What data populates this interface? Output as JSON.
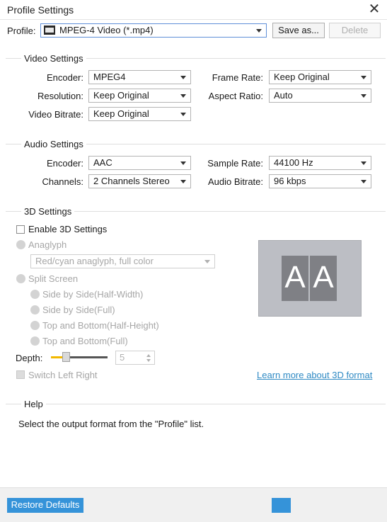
{
  "window": {
    "title": "Profile Settings",
    "close_glyph": "✕"
  },
  "profile": {
    "label": "Profile:",
    "value": "MPEG-4 Video (*.mp4)",
    "icon": "mp4-file-icon",
    "save_as": "Save as...",
    "delete": "Delete"
  },
  "video": {
    "title": "Video Settings",
    "encoder_label": "Encoder:",
    "encoder": "MPEG4",
    "resolution_label": "Resolution:",
    "resolution": "Keep Original",
    "bitrate_label": "Video Bitrate:",
    "bitrate": "Keep Original",
    "framerate_label": "Frame Rate:",
    "framerate": "Keep Original",
    "aspect_label": "Aspect Ratio:",
    "aspect": "Auto"
  },
  "audio": {
    "title": "Audio Settings",
    "encoder_label": "Encoder:",
    "encoder": "AAC",
    "channels_label": "Channels:",
    "channels": "2 Channels Stereo",
    "samplerate_label": "Sample Rate:",
    "samplerate": "44100 Hz",
    "bitrate_label": "Audio Bitrate:",
    "bitrate": "96 kbps"
  },
  "three_d": {
    "title": "3D Settings",
    "enable_label": "Enable 3D Settings",
    "anaglyph_label": "Anaglyph",
    "anaglyph_option": "Red/cyan anaglyph, full color",
    "split_label": "Split Screen",
    "split_options": [
      "Side by Side(Half-Width)",
      "Side by Side(Full)",
      "Top and Bottom(Half-Height)",
      "Top and Bottom(Full)"
    ],
    "preview_text": [
      "A",
      "A"
    ],
    "depth_label": "Depth:",
    "depth_value": "5",
    "switch_label": "Switch Left Right",
    "learn_more": "Learn more about 3D format"
  },
  "help": {
    "title": "Help",
    "text": "Select the output format from the \"Profile\" list."
  },
  "footer": {
    "restore": "Restore Defaults"
  },
  "colors": {
    "accent": "#3593d9",
    "slider_fill": "#f2b800",
    "link": "#2f8ac4"
  }
}
